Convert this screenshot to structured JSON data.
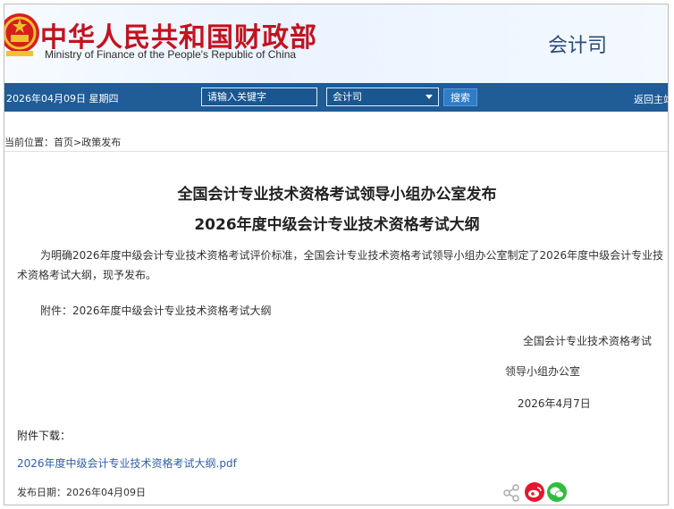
{
  "header": {
    "title": "中华人民共和国财政部",
    "subtitle": "Ministry of Finance of the People's Republic of China",
    "department": "会计司"
  },
  "topbar": {
    "date": "2026年04月09日  星期四",
    "search_placeholder": "请输入关键字",
    "scope_selected": "会计司",
    "search_button": "搜索",
    "home_link": "返回主站"
  },
  "breadcrumb": {
    "text": "当前位置：首页>政策发布"
  },
  "article": {
    "title_line1": "全国会计专业技术资格考试领导小组办公室发布",
    "title_line2": "2026年度中级会计专业技术资格考试大纲",
    "paragraph": "为明确2026年度中级会计专业技术资格考试评价标准，全国会计专业技术资格考试领导小组办公室制定了2026年度中级会计专业技术资格考试大纲，现予发布。",
    "attachment_line": "附件：2026年度中级会计专业技术资格考试大纲",
    "signature_line1": "全国会计专业技术资格考试",
    "signature_line2": "领导小组办公室",
    "signature_date": "2026年4月7日"
  },
  "downloads": {
    "label": "附件下载：",
    "file_link": "2026年度中级会计专业技术资格考试大纲.pdf"
  },
  "footer": {
    "publish_date": "发布日期：2026年04月09日"
  },
  "colors": {
    "title_red": "#c4121f",
    "bar_blue": "#1f5c98",
    "link_blue": "#2f5fb0",
    "weibo_red": "#e6162d",
    "wechat_green": "#2fbd3e"
  },
  "icons": [
    "national-emblem-icon",
    "chevron-down-icon",
    "share-icon",
    "weibo-icon",
    "wechat-icon"
  ]
}
